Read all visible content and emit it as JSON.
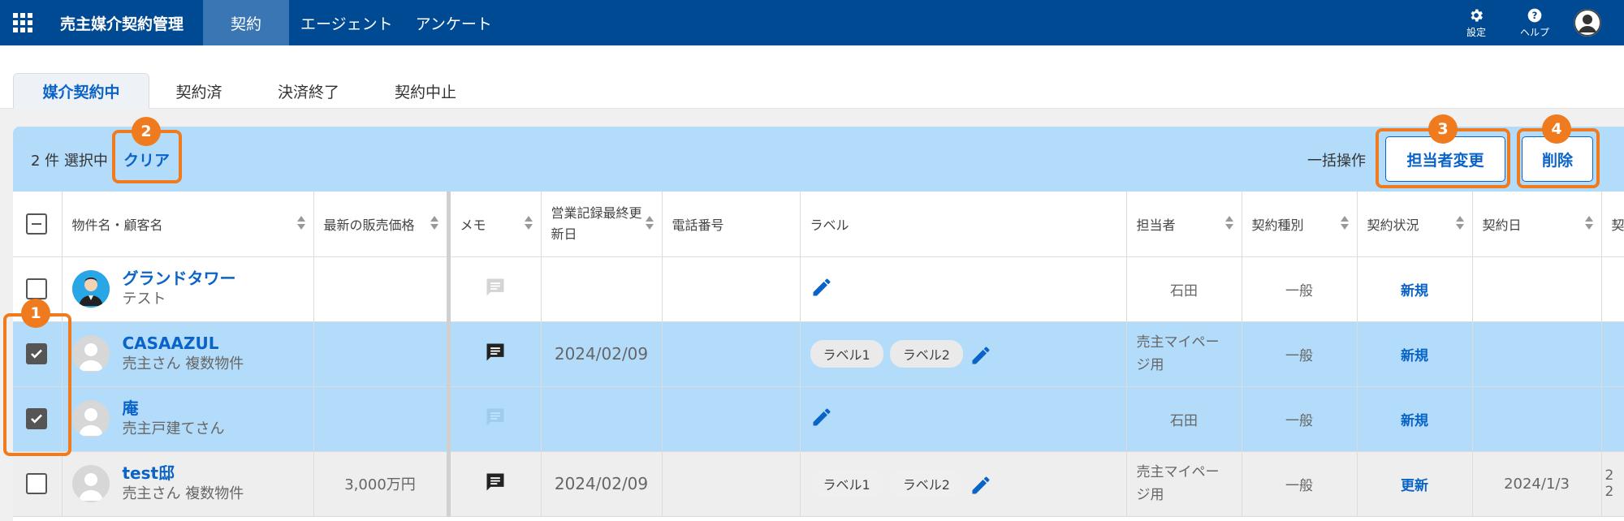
{
  "header": {
    "app_name": "売主媒介契約管理",
    "nav": [
      "契約",
      "エージェント",
      "アンケート"
    ],
    "settings_label": "設定",
    "help_label": "ヘルプ"
  },
  "tabs": [
    "媒介契約中",
    "契約済",
    "決済終了",
    "契約中止"
  ],
  "bulk": {
    "selected_text": "2 件 選択中",
    "clear_label": "クリア",
    "bulk_label": "一括操作",
    "change_owner_label": "担当者変更",
    "delete_label": "削除"
  },
  "table": {
    "columns": [
      "物件名・顧客名",
      "最新の販売価格",
      "メモ",
      "営業記録最終更新日",
      "電話番号",
      "ラベル",
      "担当者",
      "契約種別",
      "契約状況",
      "契約日",
      "契"
    ],
    "rows": [
      {
        "name": "グランドタワー",
        "sub": "テスト",
        "price": "",
        "date": "",
        "labels": [],
        "owner": "石田",
        "type": "一般",
        "status": "新規",
        "contract_date": "",
        "extra": ""
      },
      {
        "name": "CASAAZUL",
        "sub": "売主さん 複数物件",
        "price": "",
        "date": "2024/02/09",
        "labels": [
          "ラベル1",
          "ラベル2"
        ],
        "owner": "売主マイページ用",
        "type": "一般",
        "status": "新規",
        "contract_date": "",
        "extra": ""
      },
      {
        "name": "庵",
        "sub": "売主戸建てさん",
        "price": "",
        "date": "",
        "labels": [],
        "owner": "石田",
        "type": "一般",
        "status": "新規",
        "contract_date": "",
        "extra": ""
      },
      {
        "name": "test邸",
        "sub": "売主さん 複数物件",
        "price": "3,000万円",
        "date": "2024/02/09",
        "labels": [
          "ラベル1",
          "ラベル2"
        ],
        "owner": "売主マイページ用",
        "type": "一般",
        "status": "更新",
        "contract_date": "2024/1/3",
        "extra": "2\n2"
      }
    ]
  },
  "annotations": [
    "1",
    "2",
    "3",
    "4"
  ],
  "colors": {
    "header": "#004a93",
    "accent": "#0a64c8",
    "selected_row": "#b3dcfb",
    "annotation": "#f07b1e"
  }
}
